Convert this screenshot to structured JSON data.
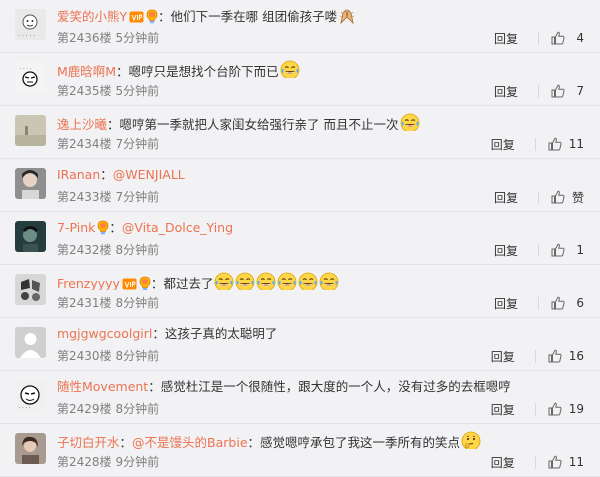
{
  "comments": [
    {
      "user": "爱笑的小熊Y",
      "badges": [
        "vip",
        "bulb"
      ],
      "text": "他们下一季在哪 组团偷孩子喽",
      "mention": "",
      "emojis": [
        "hands"
      ],
      "floor": "第2436楼",
      "time": "5分钟前",
      "reply": "回复",
      "likes": "4",
      "avatar_color": "#e9e9e9"
    },
    {
      "user": "M鹿晗啊M",
      "badges": [],
      "text": "嗯哼只是想找个台阶下而已",
      "mention": "",
      "emojis": [
        "laugh"
      ],
      "floor": "第2435楼",
      "time": "5分钟前",
      "reply": "回复",
      "likes": "7",
      "avatar_color": "#f4f4f4"
    },
    {
      "user": "逸上沙曦",
      "badges": [],
      "text": "嗯哼第一季就把人家闺女给强行亲了 而且不止一次",
      "mention": "",
      "emojis": [
        "cry"
      ],
      "floor": "第2434楼",
      "time": "7分钟前",
      "reply": "回复",
      "likes": "11",
      "avatar_color": "#c9c6b4"
    },
    {
      "user": "IRanan",
      "badges": [],
      "text": "",
      "mention": "@WENJIALL",
      "emojis": [],
      "floor": "第2433楼",
      "time": "7分钟前",
      "reply": "回复",
      "likes": "赞",
      "avatar_color": "#8f8f8f"
    },
    {
      "user": "7-Pink",
      "badges": [
        "bulb"
      ],
      "text": "",
      "mention": "@Vita_Dolce_Ying",
      "emojis": [],
      "floor": "第2432楼",
      "time": "8分钟前",
      "reply": "回复",
      "likes": "1",
      "avatar_color": "#263d3e"
    },
    {
      "user": "Frenzyyyy",
      "badges": [
        "vip",
        "bulb"
      ],
      "text": "都过去了",
      "mention": "",
      "emojis": [
        "cry",
        "cry",
        "cry",
        "cry",
        "cry",
        "cry"
      ],
      "floor": "第2431楼",
      "time": "8分钟前",
      "reply": "回复",
      "likes": "6",
      "avatar_color": "#d7d7d7"
    },
    {
      "user": "mgjgwgcoolgirl",
      "badges": [],
      "text": "这孩子真的太聪明了",
      "mention": "",
      "emojis": [],
      "floor": "第2430楼",
      "time": "8分钟前",
      "reply": "回复",
      "likes": "16",
      "avatar_color": "#cfcfcf"
    },
    {
      "user": "随性Movement",
      "badges": [],
      "text": "感觉杜江是一个很随性，跟大度的一个人，没有过多的去框嗯哼",
      "mention": "",
      "emojis": [],
      "floor": "第2429楼",
      "time": "8分钟前",
      "reply": "回复",
      "likes": "19",
      "avatar_color": "#f0f0f0"
    },
    {
      "user": "子切白开水",
      "badges": [],
      "text": "感觉嗯哼承包了我这一季所有的笑点",
      "mention": "@不是馒头的Barbie",
      "emojis": [
        "think"
      ],
      "floor": "第2428楼",
      "time": "9分钟前",
      "reply": "回复",
      "likes": "11",
      "avatar_color": "#a99a90"
    }
  ],
  "colors": {
    "username": "#eb7350",
    "meta": "#808080",
    "background": "#f2f2f5"
  },
  "icons": {
    "like": "thumbs-up-icon",
    "vip": "vip-badge-icon",
    "bulb": "lightbulb-badge-icon"
  }
}
